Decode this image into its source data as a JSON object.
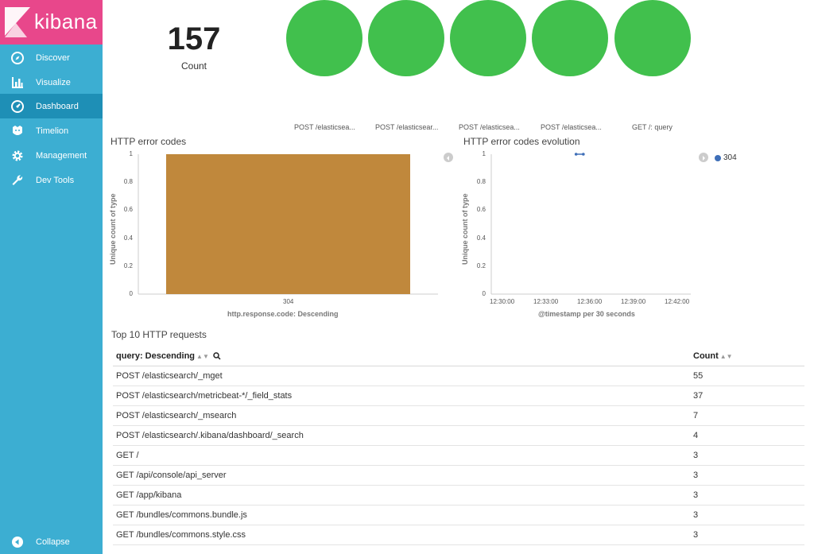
{
  "app": {
    "logo_text": "kibana"
  },
  "sidebar": {
    "items": [
      {
        "label": "Discover",
        "icon": "compass-icon",
        "active": false
      },
      {
        "label": "Visualize",
        "icon": "bar-chart-icon",
        "active": false
      },
      {
        "label": "Dashboard",
        "icon": "dashboard-icon",
        "active": true
      },
      {
        "label": "Timelion",
        "icon": "timelion-icon",
        "active": false
      },
      {
        "label": "Management",
        "icon": "gear-icon",
        "active": false
      },
      {
        "label": "Dev Tools",
        "icon": "wrench-icon",
        "active": false
      }
    ],
    "collapse_label": "Collapse"
  },
  "metric": {
    "value": "157",
    "label": "Count"
  },
  "goal_circles": {
    "color": "#41c04d",
    "labels": [
      "POST /elasticsea...",
      "POST /elasticsear...",
      "POST /elasticsea...",
      "POST /elasticsea...",
      "GET /: query"
    ]
  },
  "chart_data": [
    {
      "type": "bar",
      "title": "HTTP error codes",
      "categories": [
        "304"
      ],
      "values": [
        1
      ],
      "xlabel": "http.response.code: Descending",
      "ylabel": "Unique count of type",
      "yticks": [
        "1",
        "0.8",
        "0.6",
        "0.4",
        "0.2",
        "0"
      ],
      "ylim": [
        0,
        1
      ],
      "color": "#c0883c"
    },
    {
      "type": "line",
      "title": "HTTP error codes evolution",
      "xticks": [
        "12:30:00",
        "12:33:00",
        "12:36:00",
        "12:39:00",
        "12:42:00"
      ],
      "yticks": [
        "1",
        "0.8",
        "0.6",
        "0.4",
        "0.2",
        "0"
      ],
      "ylim": [
        0,
        1
      ],
      "xlabel": "@timestamp per 30 seconds",
      "ylabel": "Unique count of type",
      "series": [
        {
          "name": "304",
          "color": "#3f6fb8",
          "points": [
            [
              "12:35:00",
              1
            ],
            [
              "12:35:30",
              1
            ]
          ]
        }
      ],
      "legend": [
        "304"
      ]
    }
  ],
  "table": {
    "title": "Top 10 HTTP requests",
    "headers": [
      "query: Descending",
      "Count"
    ],
    "rows": [
      [
        "POST /elasticsearch/_mget",
        "55"
      ],
      [
        "POST /elasticsearch/metricbeat-*/_field_stats",
        "37"
      ],
      [
        "POST /elasticsearch/_msearch",
        "7"
      ],
      [
        "POST /elasticsearch/.kibana/dashboard/_search",
        "4"
      ],
      [
        "GET /",
        "3"
      ],
      [
        "GET /api/console/api_server",
        "3"
      ],
      [
        "GET /app/kibana",
        "3"
      ],
      [
        "GET /bundles/commons.bundle.js",
        "3"
      ],
      [
        "GET /bundles/commons.style.css",
        "3"
      ]
    ]
  }
}
